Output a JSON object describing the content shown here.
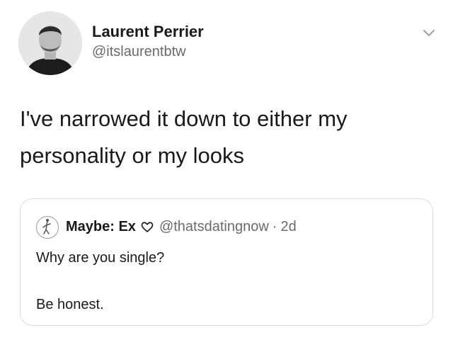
{
  "author": {
    "name": "Laurent Perrier",
    "handle": "@itslaurentbtw"
  },
  "tweet": {
    "text_line1": "I've narrowed it down to either my",
    "text_line2": "personality or my looks"
  },
  "quoted": {
    "name": "Maybe: Ex",
    "badge_icon": "heart-outline-icon",
    "handle": "@thatsdatingnow",
    "separator": "·",
    "time": "2d",
    "line1": "Why are you single?",
    "line2": "Be honest."
  },
  "icons": {
    "menu": "chevron-down-icon"
  },
  "colors": {
    "text": "#1a1a1a",
    "secondary": "#6b6b6b",
    "border": "#dcdcdc"
  }
}
